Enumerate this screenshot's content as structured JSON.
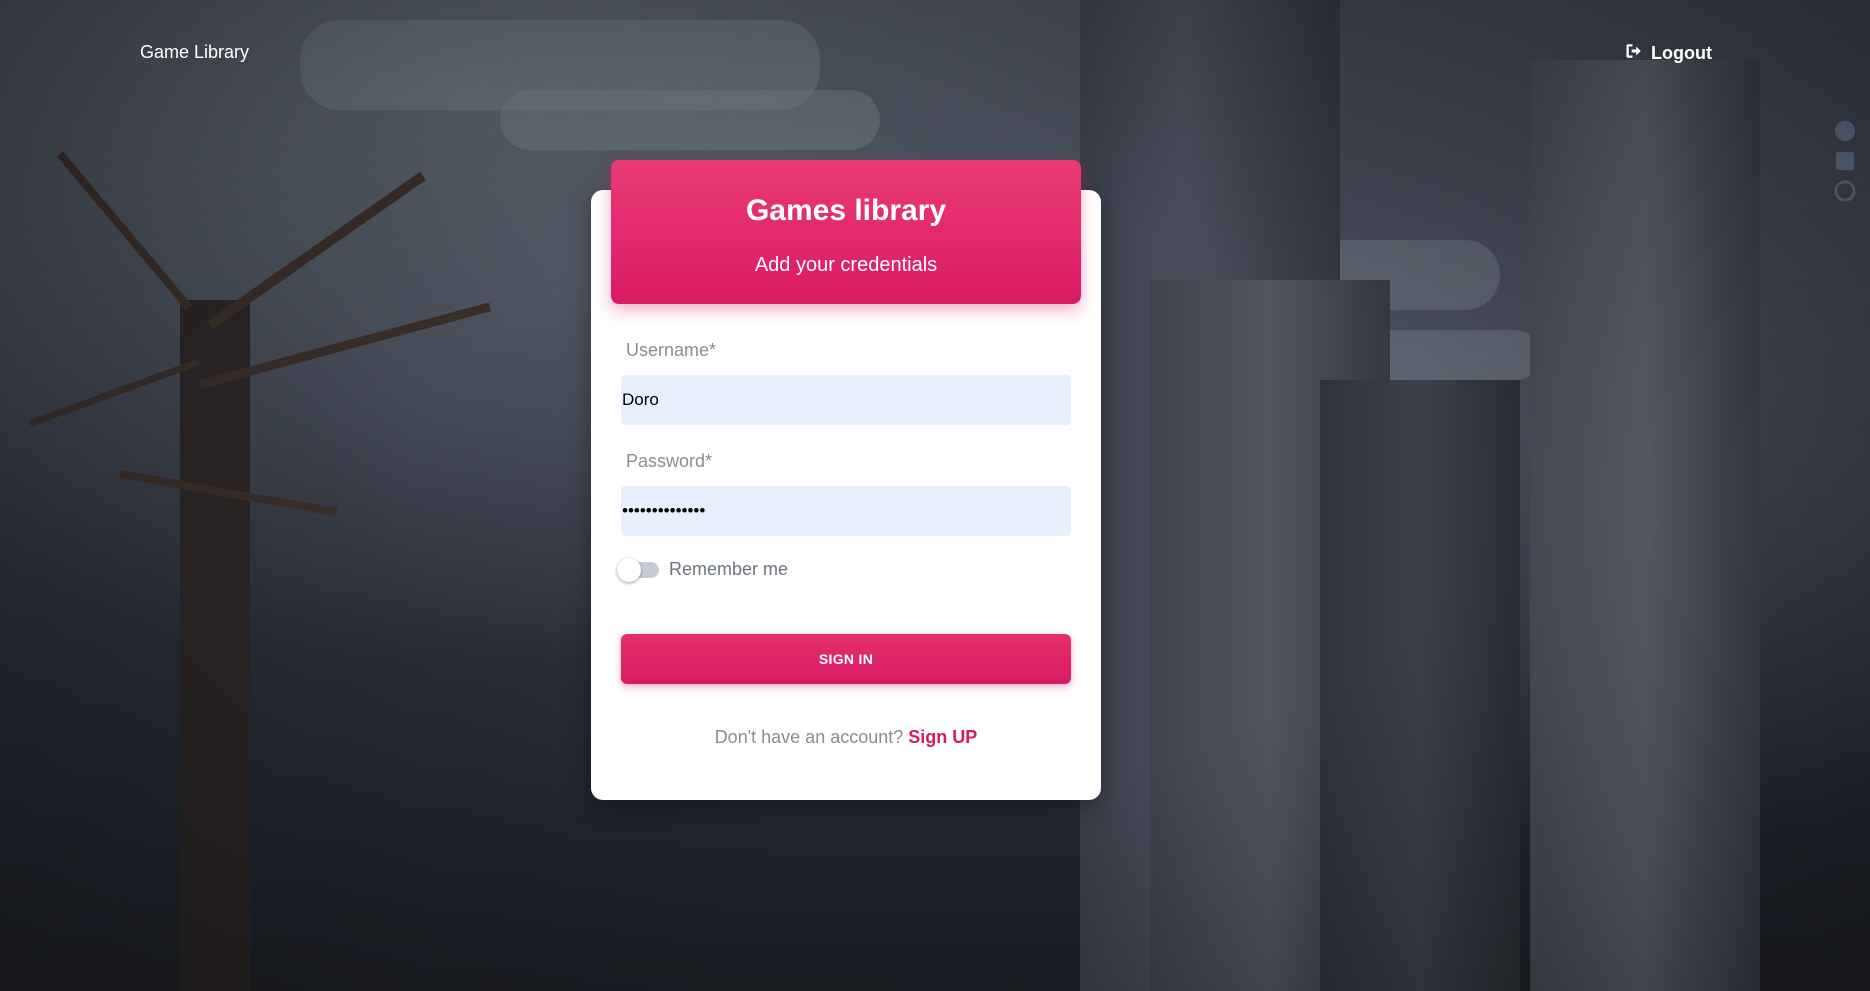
{
  "nav": {
    "brand": "Game Library",
    "logout_label": "Logout"
  },
  "card": {
    "title": "Games library",
    "subtitle": "Add your credentials"
  },
  "form": {
    "username_label": "Username*",
    "username_value": "Doro",
    "password_label": "Password*",
    "password_value": "••••••••••••••",
    "remember_label": "Remember me",
    "remember_checked": false,
    "signin_label": "SIGN IN"
  },
  "signup": {
    "prompt": "Don't have an account?",
    "link_label": "Sign UP"
  },
  "colors": {
    "accent": "#d81b60",
    "input_bg": "#e8f0fe",
    "card_bg": "#ffffff"
  },
  "icons": {
    "logout": "sign-out-icon",
    "social": [
      "facebook-icon",
      "linkedin-icon",
      "github-icon"
    ]
  }
}
